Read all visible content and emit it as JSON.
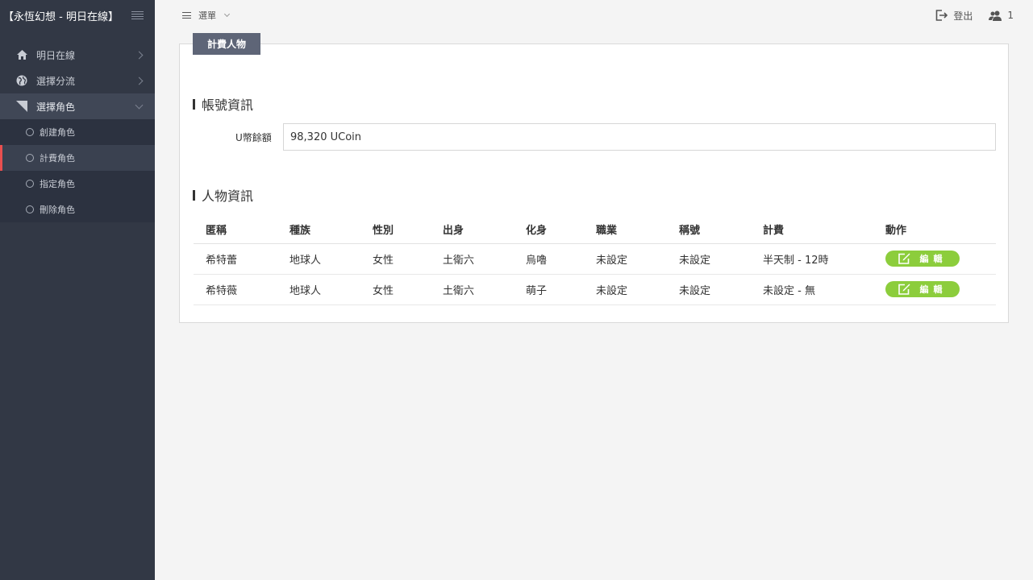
{
  "sidebar": {
    "brand": "【永恆幻想 - 明日在線】",
    "menu": [
      {
        "label": "明日在線",
        "icon": "home-icon"
      },
      {
        "label": "選擇分流",
        "icon": "globe-icon"
      },
      {
        "label": "選擇角色",
        "icon": "arrow-icon"
      }
    ],
    "submenu": [
      {
        "label": "創建角色"
      },
      {
        "label": "計費角色"
      },
      {
        "label": "指定角色"
      },
      {
        "label": "刪除角色"
      }
    ]
  },
  "topbar": {
    "menu_label": "選單",
    "logout_label": "登出",
    "user_count": "1"
  },
  "panel": {
    "tab_label": "計費人物",
    "account_section": "帳號資訊",
    "balance_label": "U幣餘額",
    "balance_value": "98,320 UCoin",
    "character_section": "人物資訊",
    "columns": [
      "匿稱",
      "種族",
      "性別",
      "出身",
      "化身",
      "職業",
      "稱號",
      "計費",
      "動作"
    ],
    "rows": [
      [
        "希特蕾",
        "地球人",
        "女性",
        "土衛六",
        "烏嚕",
        "未設定",
        "未設定",
        "半天制 - 12時"
      ],
      [
        "希特薇",
        "地球人",
        "女性",
        "土衛六",
        "萌子",
        "未設定",
        "未設定",
        "未設定 - 無"
      ]
    ],
    "edit_label": "編輯"
  },
  "colors": {
    "sidebar_bg": "#323845",
    "active_indicator": "#e94f4f",
    "edit_button": "#8ccd3c",
    "tab_bg": "#5e6577"
  }
}
